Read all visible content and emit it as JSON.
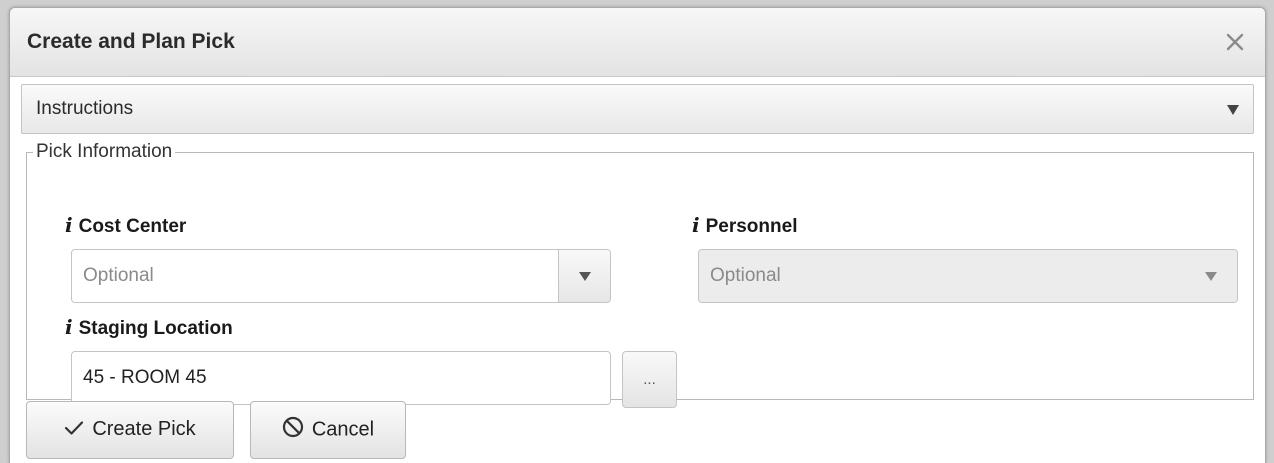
{
  "dialog": {
    "title": "Create and Plan Pick",
    "close_icon": "close-icon"
  },
  "instructions": {
    "label": "Instructions",
    "expand_icon": "caret-down-icon"
  },
  "pick_information": {
    "legend": "Pick Information",
    "cost_center": {
      "info_icon": "i",
      "label": "Cost Center",
      "placeholder": "Optional",
      "disabled": false
    },
    "personnel": {
      "info_icon": "i",
      "label": "Personnel",
      "placeholder": "Optional",
      "disabled": true
    },
    "staging_location": {
      "info_icon": "i",
      "label": "Staging Location",
      "value": "45 - ROOM 45",
      "lookup_label": "..."
    }
  },
  "actions": {
    "create_pick": {
      "label": "Create Pick",
      "icon": "checkmark-icon"
    },
    "cancel": {
      "label": "Cancel",
      "icon": "prohibited-icon"
    }
  }
}
